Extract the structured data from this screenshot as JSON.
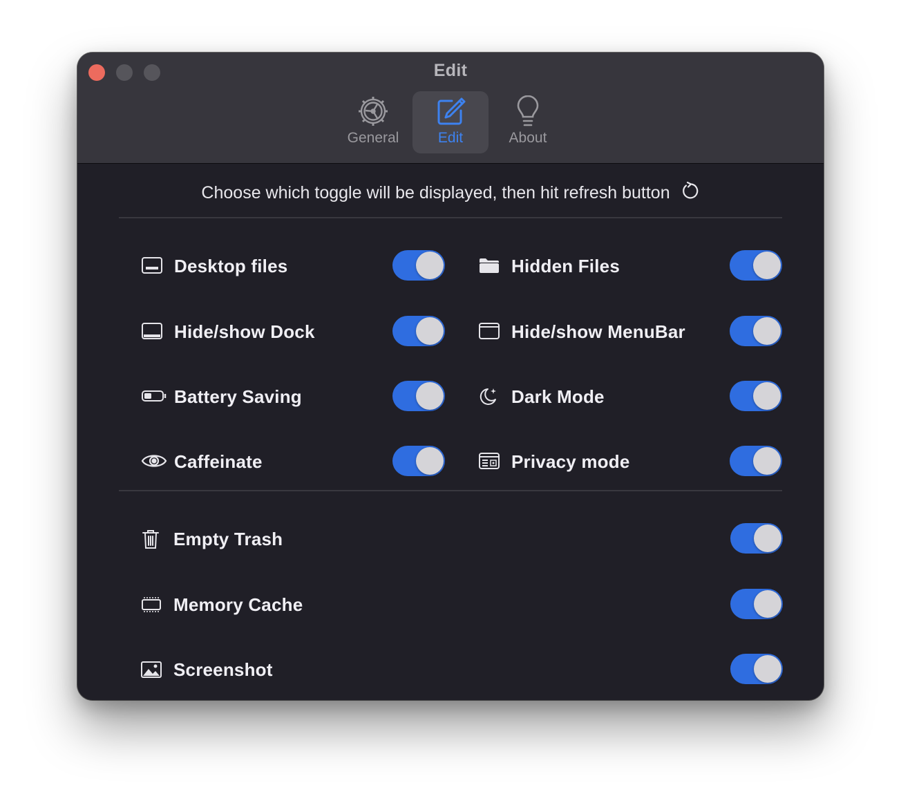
{
  "window": {
    "title": "Edit",
    "colors": {
      "background": "#201f27",
      "titlebar": "#37363d",
      "accent": "#2f6de0",
      "close": "#ec6b5e"
    }
  },
  "toolbar": {
    "tabs": [
      {
        "label": "General",
        "icon": "gear-icon",
        "active": false
      },
      {
        "label": "Edit",
        "icon": "edit-icon",
        "active": true
      },
      {
        "label": "About",
        "icon": "lightbulb-icon",
        "active": false
      }
    ]
  },
  "main": {
    "hint": "Choose which toggle will be displayed, then hit refresh button",
    "hint_icon": "refresh-icon",
    "toggles": [
      {
        "label": "Desktop files",
        "icon": "desktop-icon",
        "on": true
      },
      {
        "label": "Hidden Files",
        "icon": "folder-icon",
        "on": true
      },
      {
        "label": "Hide/show Dock",
        "icon": "dock-icon",
        "on": true
      },
      {
        "label": "Hide/show MenuBar",
        "icon": "menubar-icon",
        "on": true
      },
      {
        "label": "Battery Saving",
        "icon": "battery-icon",
        "on": true
      },
      {
        "label": "Dark Mode",
        "icon": "moon-icon",
        "on": true
      },
      {
        "label": "Caffeinate",
        "icon": "eye-icon",
        "on": true
      },
      {
        "label": "Privacy mode",
        "icon": "privacy-icon",
        "on": true
      }
    ],
    "actions": [
      {
        "label": "Empty Trash",
        "icon": "trash-icon",
        "on": true
      },
      {
        "label": "Memory Cache",
        "icon": "memory-icon",
        "on": true
      },
      {
        "label": "Screenshot",
        "icon": "screenshot-icon",
        "on": true
      }
    ]
  }
}
